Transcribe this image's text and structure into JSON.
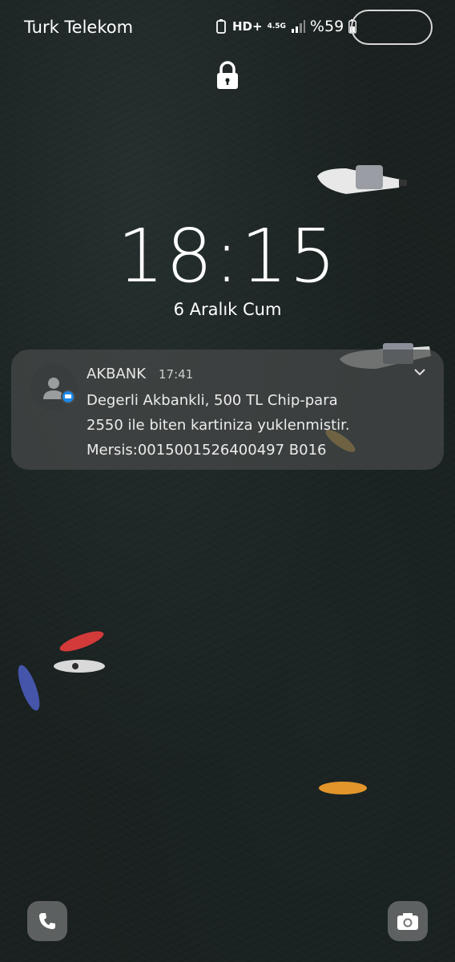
{
  "status_bar": {
    "carrier": "Turk Telekom",
    "network_hd": "HD+",
    "network_gen": "4.5G",
    "battery": "%59",
    "icons": [
      "recycle-icon",
      "hd-voice-icon",
      "network-4-5g-icon",
      "signal-icon",
      "battery-icon"
    ]
  },
  "lock_screen": {
    "time": "18:15",
    "date": "6 Aralık Cum"
  },
  "notification": {
    "app": "AKBANK",
    "time": "17:41",
    "lines": [
      "Degerli Akbankli, 500 TL Chip-para",
      "2550 ile biten kartiniza yuklenmistir.",
      "Mersis:0015001526400497 B016"
    ]
  },
  "shortcuts": {
    "left": "phone-icon",
    "right": "camera-icon"
  }
}
